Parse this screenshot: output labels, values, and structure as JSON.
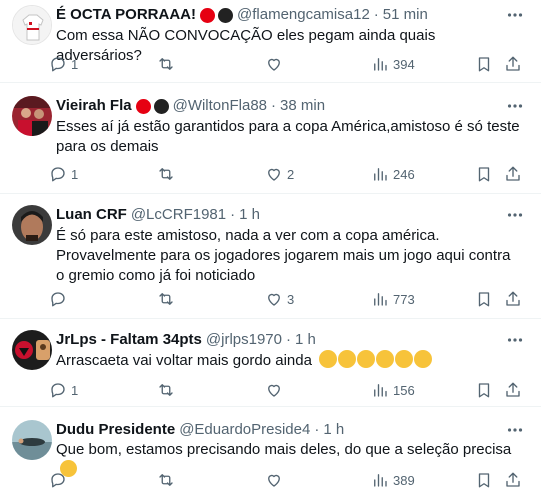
{
  "tweets": [
    {
      "name": "É OCTA PORRAAA!",
      "handle": "@flamengcamisa12",
      "separator": "·",
      "time": "51 min",
      "text": "Com essa NÃO CONVOCAÇÃO eles pegam ainda quais adversários?",
      "replies": "1",
      "retweets": "",
      "likes": "",
      "views": "394"
    },
    {
      "name": "Vieirah Fla",
      "handle": "@WiltonFla88",
      "separator": "·",
      "time": "38 min",
      "text": "Esses aí já estão garantidos para a copa América,amistoso é só teste para os demais",
      "replies": "1",
      "retweets": "",
      "likes": "2",
      "views": "246"
    },
    {
      "name": "Luan CRF",
      "handle": "@LcCRF1981",
      "separator": "·",
      "time": "1 h",
      "text": "É só para este amistoso, nada a ver com a copa américa. Provavelmente para os jogadores jogarem mais um jogo aqui contra o gremio como já foi noticiado",
      "replies": "",
      "retweets": "",
      "likes": "3",
      "views": "773"
    },
    {
      "name": "JrLps - Faltam 34pts",
      "handle": "@jrlps1970",
      "separator": "·",
      "time": "1 h",
      "text": "Arrascaeta vai voltar mais gordo ainda",
      "replies": "1",
      "retweets": "",
      "likes": "",
      "views": "156"
    },
    {
      "name": "Dudu Presidente",
      "handle": "@EduardoPreside4",
      "separator": "·",
      "time": "1 h",
      "text": "Que bom, estamos precisando mais deles, do que a seleção precisa",
      "replies": "",
      "retweets": "",
      "likes": "",
      "views": "389"
    }
  ],
  "colors": {
    "text_primary": "#0f1419",
    "text_secondary": "#536471",
    "divider": "#eff3f4",
    "badge_red": "#e60012",
    "emoji_yellow": "#f7c33a"
  },
  "icons": [
    "more-icon",
    "reply-icon",
    "retweet-icon",
    "like-icon",
    "views-icon",
    "bookmark-icon",
    "share-icon",
    "rofl-emoji",
    "grin-sweat-emoji"
  ]
}
